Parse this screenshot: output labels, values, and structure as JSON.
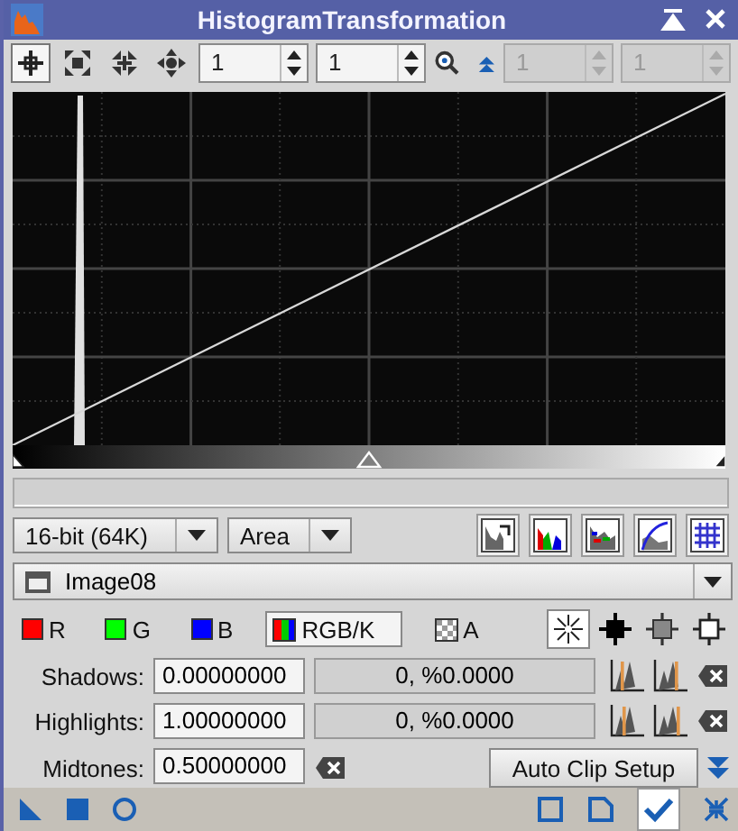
{
  "window": {
    "title": "HistogramTransformation"
  },
  "toolbar": {
    "tools": [
      {
        "kind": "crosshair",
        "selected": true
      },
      {
        "kind": "expand",
        "selected": false
      },
      {
        "kind": "shrink",
        "selected": false
      },
      {
        "kind": "pan",
        "selected": false
      }
    ],
    "zoom_fields": [
      {
        "value": "1",
        "disabled": false
      },
      {
        "value": "1",
        "disabled": false
      }
    ],
    "linked_fields": [
      {
        "value": "1",
        "disabled": true
      },
      {
        "value": "1",
        "disabled": true
      }
    ]
  },
  "options": {
    "resolution": "16-bit (64K)",
    "graph_style": "Area"
  },
  "view": {
    "name": "Image08"
  },
  "channels": [
    {
      "kind": "swatch",
      "label": "R",
      "color": "#ff0000",
      "selected": false
    },
    {
      "kind": "swatch",
      "label": "G",
      "color": "#00ff00",
      "selected": false
    },
    {
      "kind": "swatch",
      "label": "B",
      "color": "#0000ff",
      "selected": false
    },
    {
      "kind": "combined",
      "label": "RGB/K",
      "selected": true
    },
    {
      "kind": "alpha",
      "label": "A",
      "selected": false
    }
  ],
  "cursor_modes": [
    {
      "kind": "burst",
      "selected": true
    },
    {
      "kind": "black",
      "selected": false
    },
    {
      "kind": "grey",
      "selected": false
    },
    {
      "kind": "white",
      "selected": false
    }
  ],
  "parameters": [
    {
      "kind": "clip",
      "label": "Shadows:",
      "value": "0.00000000",
      "readout": "0, %0.0000"
    },
    {
      "kind": "clip",
      "label": "Highlights:",
      "value": "1.00000000",
      "readout": "0, %0.0000"
    },
    {
      "kind": "balance",
      "label": "Midtones:",
      "value": "0.50000000"
    }
  ],
  "auto_clip_button": "Auto Clip Setup"
}
